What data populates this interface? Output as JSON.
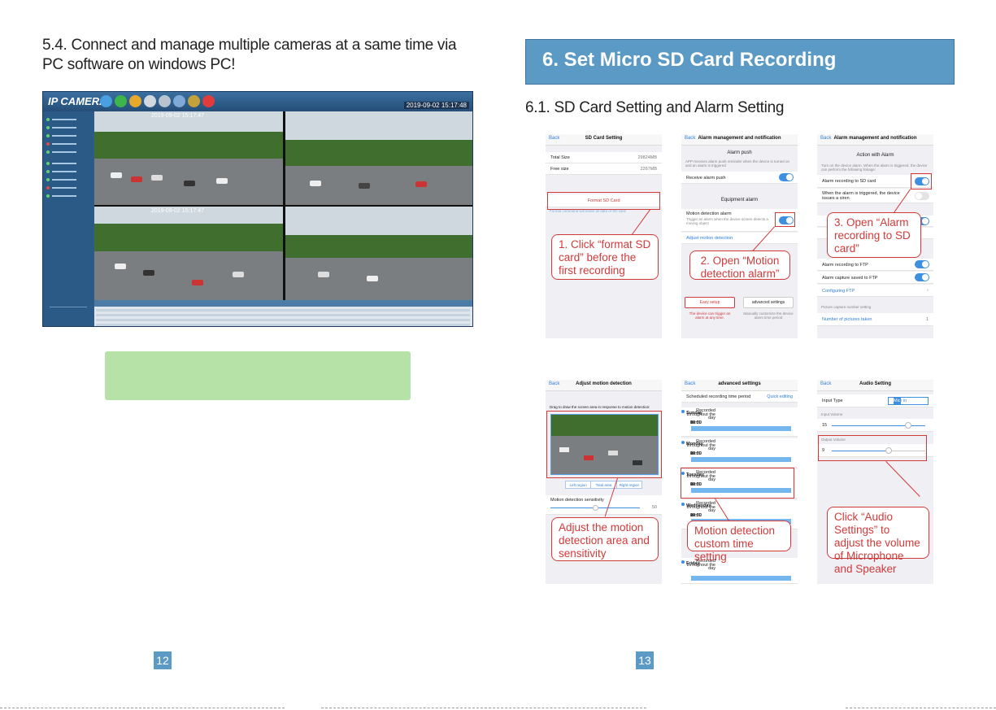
{
  "left_page": {
    "heading": "5.4. Connect and manage multiple cameras at   a same time via PC software on windows PC!",
    "pc_app": {
      "logo": "IP CAMERA",
      "clock": "2019-09-02  15:17:48",
      "feed_times": [
        "2019-09-02 15:17:47",
        "2019-09-02 15:17:47"
      ]
    },
    "page_number": "12"
  },
  "right_page": {
    "section_title": "6. Set Micro SD Card Recording",
    "subsection_title": "6.1. SD Card Setting and Alarm Setting",
    "screens": {
      "sd_card": {
        "back": "Back",
        "title": "SD Card Setting",
        "total_label": "Total Size",
        "total_value": "29824MB",
        "free_label": "Free size",
        "free_value": "2267MB",
        "format_button": "Format SD Card",
        "format_note": "Format command will erase all data of SD card"
      },
      "alarm_push": {
        "back": "Back",
        "title": "Alarm management and notification",
        "section1": "Alarm push",
        "note1": "APP receives alarm push reminder when the device is turned on and an alarm is triggered",
        "receive_push": "Receive alarm push",
        "section2": "Equipment alarm",
        "motion_label": "Motion detection alarm",
        "motion_note": "Trigger an alarm when the device screen detects a moving object",
        "adjust_link": "Adjust motion detection",
        "easy_setup": "Easy setup",
        "advanced_settings": "advanced settings",
        "easy_note": "The device can trigger an alarm at any time.",
        "adv_note": "Manually customize the device alarm time period"
      },
      "alarm_action": {
        "back": "Back",
        "title": "Alarm management and notification",
        "section": "Action with Alarm",
        "note": "Turn on the device alarm. When the alarm is triggered, the device can perform the following linkage:",
        "sd_label": "Alarm recording to SD card",
        "siren_label": "When the alarm is triggered, the device issues a siren",
        "ftp_label": "Alarm recording to FTP",
        "ftp_capture": "Alarm capture saved to FTP",
        "config_ftp": "Configuring FTP",
        "pictures_section": "Picture capture number setting",
        "pictures_label": "Number of pictures taken",
        "pictures_value": "1"
      },
      "motion": {
        "back": "Back",
        "title": "Adjust motion detection",
        "instruction": "Drag to draw the screen area in response to motion detection:",
        "region_buttons": [
          "Left region",
          "Total area",
          "Right region"
        ],
        "sensitivity_label": "Motion detection sensitivity",
        "sensitivity_value": "50"
      },
      "advanced": {
        "back": "Back",
        "title": "advanced settings",
        "subtitle": "Scheduled recording time period",
        "quick": "Quick editing",
        "days": [
          "Sunday",
          "Monday",
          "Tuesday",
          "Wednesday",
          "Friday"
        ],
        "recorded": "Recorded throughout the day",
        "ticks": [
          "00:00",
          "06:00",
          "12:00",
          "18:00",
          "23:59"
        ]
      },
      "audio": {
        "back": "Back",
        "title": "Audio Setting",
        "input_type": "Input Type",
        "seg": [
          "Line in",
          "Mic"
        ],
        "input_volume_label": "Input Volume",
        "input_volume": "15",
        "output_volume_label": "Output Volume",
        "output_volume": "9"
      }
    },
    "callouts": {
      "c1": "1. Click “format SD card” before the first recording",
      "c2": "2. Open “Motion detection alarm”",
      "c3": "3. Open “Alarm recording to SD card”",
      "c4": "Adjust the motion detection area and sensitivity",
      "c5": "Motion detection custom time setting",
      "c6": "Click “Audio Settings” to adjust the volume of Microphone and Speaker"
    },
    "page_number": "13"
  },
  "colors": {
    "accent_blue": "#5b9ac4",
    "callout_red": "#d23a3a",
    "note_green": "#b6e2a8",
    "ios_blue": "#3d8fe0"
  }
}
